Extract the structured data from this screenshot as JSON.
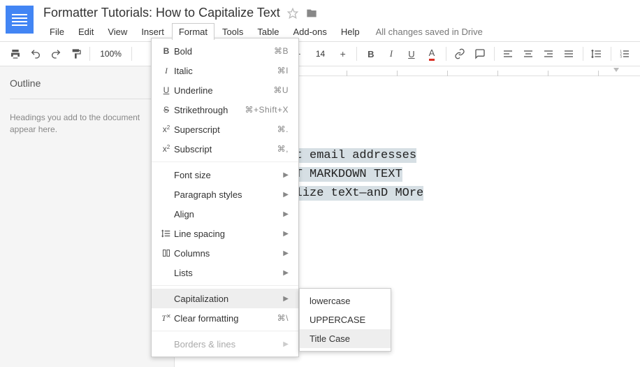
{
  "doc": {
    "title": "Formatter Tutorials: How to Capitalize Text",
    "save_status": "All changes saved in Drive"
  },
  "menubar": {
    "file": "File",
    "edit": "Edit",
    "view": "View",
    "insert": "Insert",
    "format": "Format",
    "tools": "Tools",
    "table": "Table",
    "addons": "Add-ons",
    "help": "Help"
  },
  "toolbar": {
    "zoom": "100%",
    "font_size": "14"
  },
  "sidebar": {
    "title": "Outline",
    "hint": "Headings you add to the document appear here."
  },
  "document": {
    "line1": "how to extract email addresses",
    "line2": "HOW TO CONVERT MARKDOWN TEXT",
    "line3": "HOw to cApitalize teXt—anD MOre"
  },
  "format_menu": {
    "bold": "Bold",
    "sc_bold": "⌘B",
    "italic": "Italic",
    "sc_italic": "⌘I",
    "underline": "Underline",
    "sc_underline": "⌘U",
    "strike": "Strikethrough",
    "sc_strike": "⌘+Shift+X",
    "superscript": "Superscript",
    "sc_superscript": "⌘.",
    "subscript": "Subscript",
    "sc_subscript": "⌘,",
    "font_size": "Font size",
    "paragraph": "Paragraph styles",
    "align": "Align",
    "line_spacing": "Line spacing",
    "columns": "Columns",
    "lists": "Lists",
    "capitalization": "Capitalization",
    "clear": "Clear formatting",
    "sc_clear": "⌘\\",
    "borders": "Borders & lines"
  },
  "cap_menu": {
    "lower": "lowercase",
    "upper": "UPPERCASE",
    "title": "Title Case"
  }
}
